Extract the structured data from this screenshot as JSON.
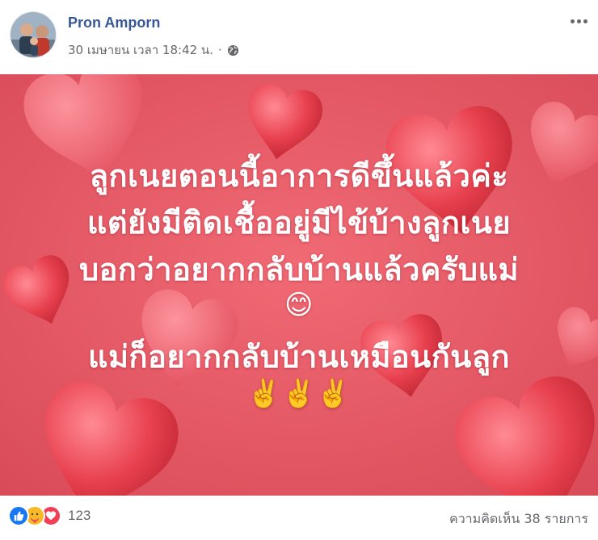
{
  "post": {
    "author_name": "Pron Amporn",
    "timestamp": "30 เมษายน เวลา 18:42 น.",
    "separator": "·",
    "privacy_icon": "globe-icon",
    "more_icon": "more-dots-icon"
  },
  "image": {
    "background_color": "#e0505e",
    "heart_color": "#e8404e",
    "lines": [
      "ลูกเนยตอนนี้อาการดีขึ้นแล้วค่ะ",
      "แต่ยังมีติดเชื้ออยู่มีไข้บ้างลูกเนย",
      "บอกว่าอยากกลับบ้านแล้วครับแม่",
      "😊",
      "แม่ก็อยากกลับบ้านเหมือนกันลูก",
      "✌️✌️✌️"
    ]
  },
  "footer": {
    "reaction_icons": [
      "like-icon",
      "care-icon",
      "love-icon"
    ],
    "reaction_count": "123",
    "comments_label": "ความคิดเห็น 38 รายการ"
  },
  "colors": {
    "author_link": "#385898",
    "secondary_text": "#65676b",
    "like_blue": "#1877f2",
    "love_red": "#f33e58",
    "care_yellow": "#f7b928"
  }
}
